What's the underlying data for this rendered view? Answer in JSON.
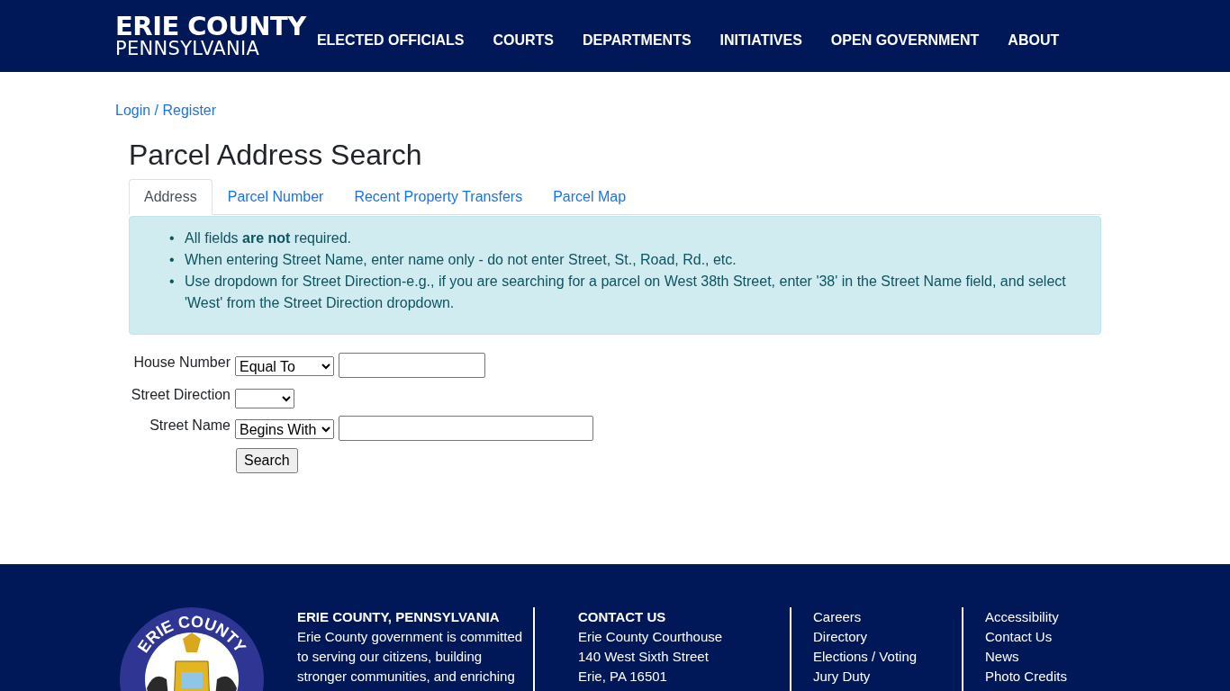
{
  "header": {
    "logo": {
      "line_1": "ERIE COUNTY",
      "line_2": "PENNSYLVANIA"
    },
    "nav": [
      "ELECTED OFFICIALS",
      "COURTS",
      "DEPARTMENTS",
      "INITIATIVES",
      "OPEN GOVERNMENT",
      "ABOUT"
    ]
  },
  "login_link": "Login / Register",
  "title": "Parcel Address Search",
  "tabs": [
    {
      "label": "Address",
      "selected": true
    },
    {
      "label": "Parcel Number",
      "selected": false
    },
    {
      "label": "Recent Property Transfers",
      "selected": false
    },
    {
      "label": "Parcel Map",
      "selected": false
    }
  ],
  "notes": [
    {
      "bullet": "•",
      "text": "All fields **are not** required."
    },
    {
      "bullet": "•",
      "text": "When entering Street Name, enter name only - do not enter Street, St., Road, Rd., etc."
    },
    {
      "bullet": "•",
      "text": "Use dropdown for Street Direction-e.g., if you are searching for a parcel on West 38th Street, enter '38' in the Street Name field, and select 'West' from the Street Direction dropdown."
    }
  ],
  "form": {
    "rows": [
      {
        "label": "House Number",
        "kind": "select-input",
        "select": "Equal To"
      },
      {
        "label": "Street Direction",
        "kind": "select",
        "select": ""
      },
      {
        "label": "Street Name",
        "kind": "select-input",
        "select": "Begins With"
      }
    ],
    "button": "Search"
  },
  "footer": {
    "seal_text": "ERIE COUNTY",
    "about": {
      "heading": "ERIE COUNTY, PENNSYLVANIA",
      "lines": [
        "Erie County government is committed",
        "to serving our citizens, building",
        "stronger communities, and enriching"
      ]
    },
    "contact": {
      "heading": "CONTACT US",
      "lines": [
        "Erie County Courthouse",
        "140 West Sixth Street",
        "Erie, PA 16501"
      ]
    },
    "links_1": [
      "Careers",
      "Directory",
      "Elections / Voting",
      "Jury Duty"
    ],
    "links_2": [
      "Accessibility",
      "Contact Us",
      "News",
      "Photo Credits"
    ]
  }
}
